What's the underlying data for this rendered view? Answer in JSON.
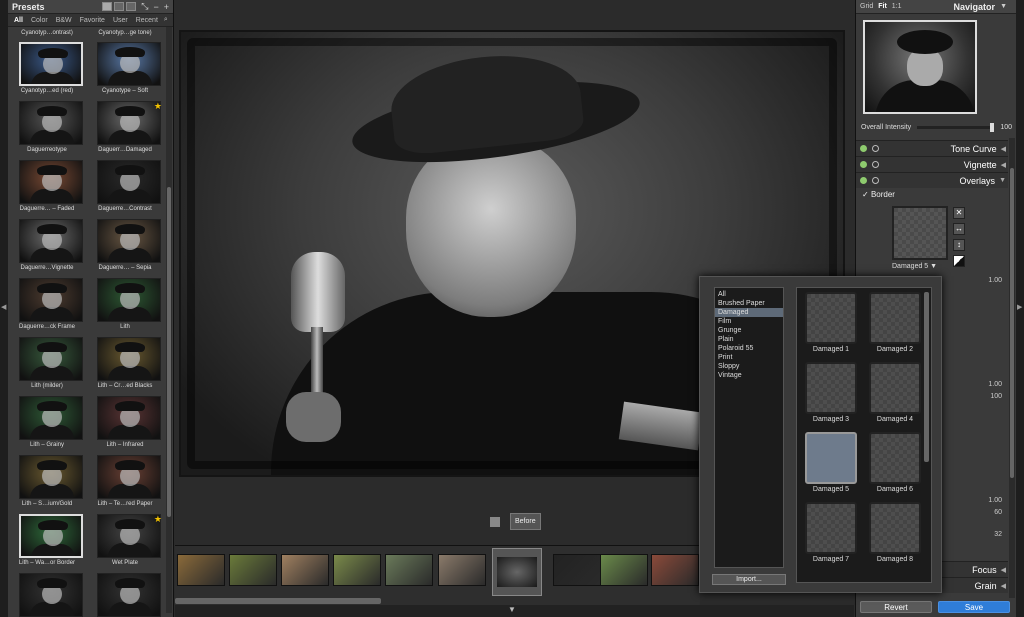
{
  "presets": {
    "title": "Presets",
    "filters": [
      "All",
      "Color",
      "B&W",
      "Favorite",
      "User",
      "Recent"
    ],
    "top_labels": [
      "Cyanotyp…ontrast)",
      "Cyanotyp…ge tone)"
    ],
    "items": [
      {
        "label": "Cyanotyp…ed (red)",
        "tone": "#3b5a8a",
        "selected": true,
        "star": false
      },
      {
        "label": "Cyanotype – Soft",
        "tone": "#5a7aa8",
        "selected": false,
        "star": false
      },
      {
        "label": "Daguerreotype",
        "tone": "#555555",
        "selected": false,
        "star": false
      },
      {
        "label": "Daguerr…Damaged",
        "tone": "#6a6a6a",
        "selected": false,
        "star": true
      },
      {
        "label": "Daguerre… – Faded",
        "tone": "#7a4a34",
        "selected": false,
        "star": false
      },
      {
        "label": "Daguerre…Contrast",
        "tone": "#2a2a2a",
        "selected": false,
        "star": false
      },
      {
        "label": "Daguerre…Vignette",
        "tone": "#6c6c6c",
        "selected": false,
        "star": false
      },
      {
        "label": "Daguerre… – Sepia",
        "tone": "#6a5844",
        "selected": false,
        "star": false
      },
      {
        "label": "Daguerre…ck Frame",
        "tone": "#4e3c30",
        "selected": false,
        "star": false
      },
      {
        "label": "Lith",
        "tone": "#2e5a34",
        "selected": false,
        "star": false
      },
      {
        "label": "Lith (milder)",
        "tone": "#375a3c",
        "selected": false,
        "star": false
      },
      {
        "label": "Lith – Cr…ed Blacks",
        "tone": "#6a5a30",
        "selected": false,
        "star": false
      },
      {
        "label": "Lith – Grainy",
        "tone": "#2e5a36",
        "selected": false,
        "star": false
      },
      {
        "label": "Lith – Infrared",
        "tone": "#5a3434",
        "selected": false,
        "star": false
      },
      {
        "label": "Lith – S…ium/Gold",
        "tone": "#6a5a30",
        "selected": false,
        "star": false
      },
      {
        "label": "Lith – Te…red Paper",
        "tone": "#6a4034",
        "selected": false,
        "star": false
      },
      {
        "label": "Lith – Wa…or Border",
        "tone": "#2e6a3a",
        "selected": true,
        "star": false
      },
      {
        "label": "Wet Plate",
        "tone": "#444444",
        "selected": false,
        "star": true
      },
      {
        "label": "",
        "tone": "#333333",
        "selected": false,
        "star": false
      },
      {
        "label": "",
        "tone": "#333333",
        "selected": false,
        "star": false
      }
    ]
  },
  "viewer": {
    "before_label": "Before"
  },
  "filmstrip": {
    "thumbs": [
      {
        "tone": "#8a6a3a"
      },
      {
        "tone": "#6a7a3a"
      },
      {
        "tone": "#a08060"
      },
      {
        "tone": "#7a8a4a"
      },
      {
        "tone": "#6a7a5a"
      },
      {
        "tone": "#8a7a6a"
      },
      {
        "tone": "#3a3a3a"
      },
      {
        "tone": "#222222"
      },
      {
        "tone": "#6a8a4a"
      },
      {
        "tone": "#8a4a3a"
      }
    ],
    "selected_index": 6
  },
  "navigator": {
    "zoom_options": [
      "Grid",
      "Fit",
      "1:1"
    ],
    "title": "Navigator",
    "intensity_label": "Overall Intensity",
    "intensity_value": "100",
    "intensity_fraction": 1.0
  },
  "sections": {
    "tone_curve": "Tone Curve",
    "vignette": "Vignette",
    "overlays": "Overlays",
    "border_label": "Border",
    "border_selected": "Damaged 5",
    "focus": "Focus",
    "grain": "Grain"
  },
  "values": {
    "v1": "1.00",
    "v2": "1.00",
    "v3": "100",
    "v4": "1.00",
    "v5": "60",
    "v6": "32"
  },
  "actions": {
    "revert": "Revert",
    "save": "Save"
  },
  "border_popup": {
    "categories": [
      "All",
      "Brushed Paper",
      "Damaged",
      "Film",
      "Grunge",
      "Plain",
      "Polaroid 55",
      "Print",
      "Sloppy",
      "Vintage"
    ],
    "selected_category": "Damaged",
    "import_label": "Import...",
    "thumbnails": [
      "Damaged  1",
      "Damaged  2",
      "Damaged  3",
      "Damaged  4",
      "Damaged  5",
      "Damaged  6",
      "Damaged  7",
      "Damaged  8"
    ],
    "selected_thumbnail": "Damaged  5"
  }
}
